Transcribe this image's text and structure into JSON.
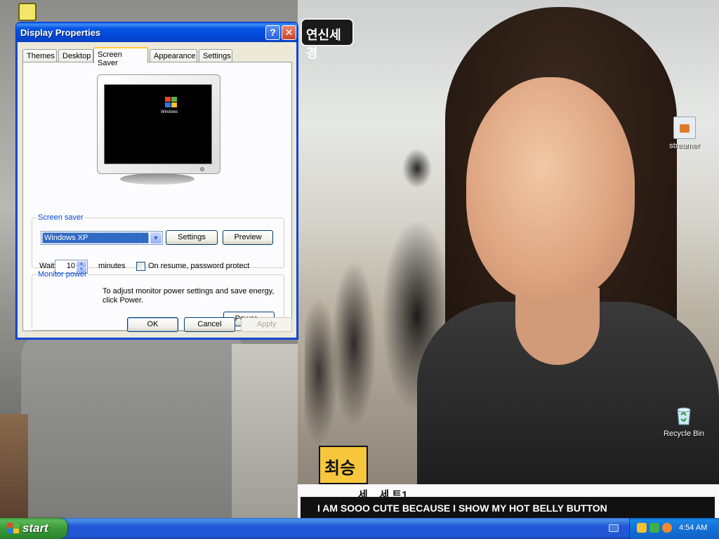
{
  "window": {
    "title": "Display Properties",
    "help_label": "?",
    "close_label": "✕",
    "tabs": [
      {
        "label": "Themes"
      },
      {
        "label": "Desktop"
      },
      {
        "label": "Screen Saver",
        "active": true
      },
      {
        "label": "Appearance"
      },
      {
        "label": "Settings"
      }
    ]
  },
  "preview": {
    "os_logo_text": "Windows"
  },
  "screen_saver": {
    "group_label": "Screen saver",
    "selected": "Windows XP",
    "settings_button": "Settings",
    "preview_button": "Preview",
    "wait_label": "Wait:",
    "wait_value": "10",
    "minutes_label": "minutes",
    "password_label": "On resume, password protect",
    "password_checked": false
  },
  "monitor_power": {
    "group_label": "Monitor power",
    "description": "To adjust monitor power settings and save energy, click Power.",
    "power_button": "Power..."
  },
  "dialog_buttons": {
    "ok": "OK",
    "cancel": "Cancel",
    "apply": "Apply"
  },
  "desktop": {
    "icons": [
      {
        "label": "streamer",
        "icon": "streamer-icon"
      },
      {
        "label": "Recycle Bin",
        "icon": "recycle-bin-icon"
      }
    ],
    "wallpaper": {
      "logo_text": "연신세경",
      "name_tag": "최승",
      "subtitle_line": "_ _  __ 세 _ 세 트1",
      "subtitle_bar": "I AM SOOO CUTE BECAUSE I SHOW MY HOT BELLY BUTTON"
    }
  },
  "taskbar": {
    "start_label": "start",
    "clock": "4:54 AM",
    "colors": {
      "taskbar": "#2157d7",
      "start": "#3a9a3a",
      "tray": "#1471d9"
    }
  }
}
